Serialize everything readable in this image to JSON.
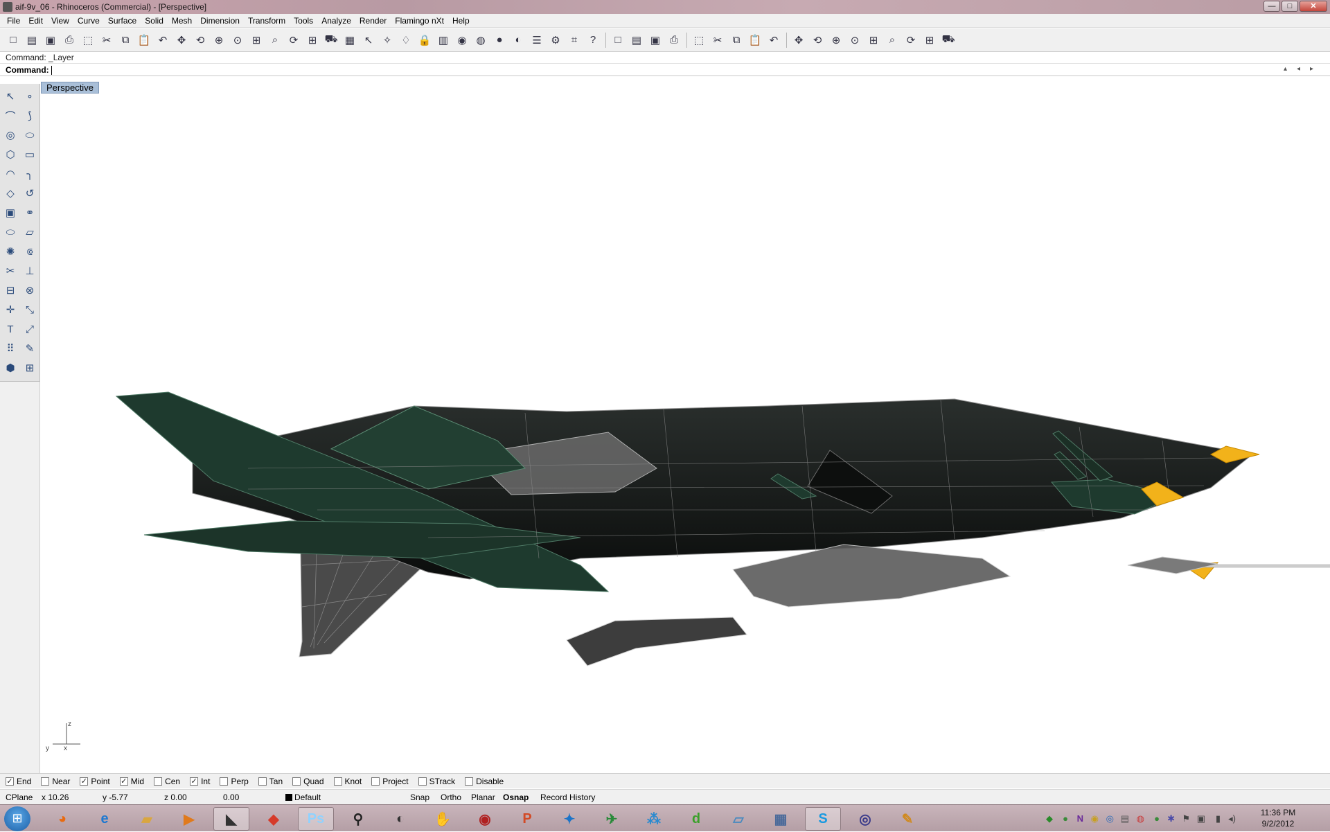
{
  "window": {
    "title": "aif-9v_06 - Rhinoceros (Commercial) - [Perspective]",
    "controls": {
      "minimize": "—",
      "maximize": "□",
      "close": "✕"
    }
  },
  "menu": [
    "File",
    "Edit",
    "View",
    "Curve",
    "Surface",
    "Solid",
    "Mesh",
    "Dimension",
    "Transform",
    "Tools",
    "Analyze",
    "Render",
    "Flamingo nXt",
    "Help"
  ],
  "toolbar": {
    "groups": [
      [
        "new-file-icon",
        "open-file-icon",
        "save-icon",
        "print-icon",
        "import-icon",
        "cut-icon",
        "copy-icon",
        "paste-icon",
        "undo-icon",
        "pan-icon",
        "rotate-view-icon",
        "zoom-icon",
        "zoom-window-icon",
        "zoom-extents-icon",
        "zoom-selected-icon",
        "undo-view-icon",
        "four-viewports-icon",
        "car-icon",
        "grid-icon",
        "select-icon",
        "snap-icon",
        "light-icon",
        "lock-icon",
        "layer-icon",
        "color-wheel-icon",
        "sphere-wireframe-icon",
        "sphere-shaded-icon",
        "render-icon",
        "options-icon",
        "gear-icon",
        "dimension-icon",
        "help-icon"
      ],
      [
        "cube-view-icon",
        "box-icon",
        "vertical-dots-icon",
        "window-icon"
      ],
      [
        "grid-dots-icon",
        "points-icon",
        "curve-points-icon",
        "grid-icon",
        "picture-icon"
      ],
      [
        "deform-icon",
        "flow-icon",
        "mesh-icon",
        "cage-icon",
        "twist-icon",
        "bend-icon",
        "taper-icon",
        "stretch-icon",
        "render-settings-icon"
      ]
    ],
    "glyphs": [
      "□",
      "▤",
      "▣",
      "⎙",
      "⬚",
      "✂",
      "⧉",
      "📋",
      "↶",
      "✥",
      "⟲",
      "⊕",
      "⊙",
      "⊞",
      "⌕",
      "⟳",
      "⊞",
      "⛟",
      "▦",
      "↖",
      "✧",
      "♢",
      "🔒",
      "▥",
      "◉",
      "◍",
      "●",
      "◐",
      "☰",
      "⚙",
      "⌗",
      "?"
    ]
  },
  "command": {
    "history": "Command: _Layer",
    "prompt_label": "Command:",
    "prompt_value": ""
  },
  "left_tools": [
    "arrow-select-icon",
    "point-icon",
    "polyline-icon",
    "curve-icon",
    "circle-icon",
    "ellipse-icon",
    "polygon-icon",
    "rectangle-icon",
    "arc-icon",
    "fillet-icon",
    "surface-icon",
    "revolve-icon",
    "box-solid-icon",
    "boolean-icon",
    "cylinder-icon",
    "plane-icon",
    "explode-icon",
    "pipe-icon",
    "trim-icon",
    "split-icon",
    "group-icon",
    "join-icon",
    "move-icon",
    "scale-icon",
    "text-icon",
    "dimension-icon",
    "array-icon",
    "analyze-icon",
    "block-icon",
    "wireframe-icon"
  ],
  "left_glyphs": [
    "↖",
    "∘",
    "⌒",
    "⟆",
    "◎",
    "⬭",
    "⬡",
    "▭",
    "◠",
    "╮",
    "◇",
    "↺",
    "▣",
    "⚭",
    "⬭",
    "▱",
    "✺",
    "⟃",
    "✂",
    "⊥",
    "⊟",
    "⊗",
    "✛",
    "⤡",
    "T",
    "⤢",
    "⠿",
    "✎",
    "⬢",
    "⊞"
  ],
  "viewport": {
    "tab_label": "Perspective",
    "axis": {
      "x": "x",
      "y": "y",
      "z": "z"
    },
    "model_colors": {
      "hull": "#101312",
      "wing": "#1f3b30",
      "edge": "#9a9a9a",
      "highlight": "#f2b21a"
    }
  },
  "osnaps": [
    {
      "label": "End",
      "checked": true
    },
    {
      "label": "Near",
      "checked": false
    },
    {
      "label": "Point",
      "checked": true
    },
    {
      "label": "Mid",
      "checked": true
    },
    {
      "label": "Cen",
      "checked": false
    },
    {
      "label": "Int",
      "checked": true
    },
    {
      "label": "Perp",
      "checked": false
    },
    {
      "label": "Tan",
      "checked": false
    },
    {
      "label": "Quad",
      "checked": false
    },
    {
      "label": "Knot",
      "checked": false
    },
    {
      "label": "Project",
      "checked": false
    },
    {
      "label": "STrack",
      "checked": false
    },
    {
      "label": "Disable",
      "checked": false
    }
  ],
  "status": {
    "cplane": "CPlane",
    "x": "x 10.26",
    "y": "y -5.77",
    "z": "z 0.00",
    "distance": "0.00",
    "layer": "Default",
    "snap": "Snap",
    "ortho": "Ortho",
    "planar": "Planar",
    "osnap": "Osnap",
    "record_history": "Record History"
  },
  "taskbar": {
    "apps": [
      {
        "name": "firefox",
        "glyph": "◕",
        "color": "#e86a10"
      },
      {
        "name": "internet-explorer",
        "glyph": "e",
        "color": "#1e78d0"
      },
      {
        "name": "file-explorer",
        "glyph": "▰",
        "color": "#d9a640"
      },
      {
        "name": "media-player",
        "glyph": "▶",
        "color": "#e07a1c"
      },
      {
        "name": "rhinoceros",
        "glyph": "◣",
        "color": "#333333"
      },
      {
        "name": "sketchup",
        "glyph": "◆",
        "color": "#d63a2a"
      },
      {
        "name": "photoshop",
        "glyph": "Ps",
        "color": "#8fd2ff"
      },
      {
        "name": "zbrush",
        "glyph": "⚲",
        "color": "#222222"
      },
      {
        "name": "steam",
        "glyph": "◐",
        "color": "#333333"
      },
      {
        "name": "hand-app",
        "glyph": "✋",
        "color": "#7a6a8a"
      },
      {
        "name": "record-app",
        "glyph": "◉",
        "color": "#b02020"
      },
      {
        "name": "powerpoint",
        "glyph": "P",
        "color": "#d24a26"
      },
      {
        "name": "bird-app",
        "glyph": "✦",
        "color": "#1c74c8"
      },
      {
        "name": "globe-app",
        "glyph": "✈",
        "color": "#2a8a3a"
      },
      {
        "name": "balls-app",
        "glyph": "⁂",
        "color": "#2a8ad0"
      },
      {
        "name": "dreamweaver",
        "glyph": "d",
        "color": "#3aa02a"
      },
      {
        "name": "notes-app",
        "glyph": "▱",
        "color": "#4a8abf"
      },
      {
        "name": "calculator",
        "glyph": "▦",
        "color": "#4a6a9a"
      },
      {
        "name": "skype",
        "glyph": "S",
        "color": "#1a9ae0"
      },
      {
        "name": "video-app",
        "glyph": "◎",
        "color": "#3a3a8a"
      },
      {
        "name": "paint-app",
        "glyph": "✎",
        "color": "#d08a20"
      }
    ],
    "clock_time": "11:36 PM",
    "clock_date": "9/2/2012"
  }
}
